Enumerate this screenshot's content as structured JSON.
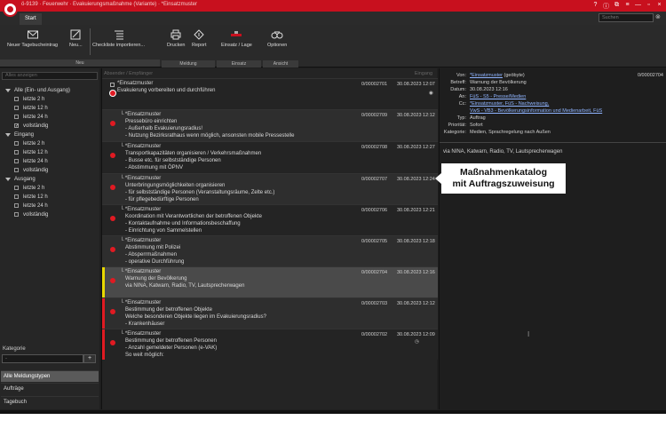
{
  "window": {
    "title": "ö-9139 · Feuerwehr · Evakuierungsmaßnahme (Variante) · *Einsatzmuster",
    "controls": [
      "?",
      "ⓘ",
      "⧉",
      "≡",
      "—",
      "▫",
      "×"
    ]
  },
  "tabs": {
    "start": "Start"
  },
  "search": {
    "placeholder": "Suchen"
  },
  "ribbon": {
    "buttons": {
      "neuer_tagebucheintrag": "Neuer Tagebucheintrag",
      "neu": "Neu...",
      "checkliste": "Checkliste importieren...",
      "drucken": "Drucken",
      "report": "Report",
      "einsatz_lage": "Einsatz / Lage",
      "optionen": "Optionen"
    },
    "groups": {
      "neu": "Neu",
      "meldung": "Meldung",
      "einsatz": "Einsatz",
      "ansicht": "Ansicht"
    }
  },
  "left": {
    "filter_placeholder": "Alles anzeigen",
    "tree": [
      {
        "type": "top",
        "label": "Alle (Ein- und Ausgang)"
      },
      {
        "type": "leaf",
        "label": "letzte 2 h",
        "checked": false
      },
      {
        "type": "leaf",
        "label": "letzte 12 h",
        "checked": false
      },
      {
        "type": "leaf",
        "label": "letzte 24 h",
        "checked": false
      },
      {
        "type": "leaf",
        "label": "vollständig",
        "checked": true
      },
      {
        "type": "top",
        "label": "Eingang"
      },
      {
        "type": "leaf",
        "label": "letzte 2 h",
        "checked": false
      },
      {
        "type": "leaf",
        "label": "letzte 12 h",
        "checked": false
      },
      {
        "type": "leaf",
        "label": "letzte 24 h",
        "checked": false
      },
      {
        "type": "leaf",
        "label": "vollständig",
        "checked": false
      },
      {
        "type": "top",
        "label": "Ausgang"
      },
      {
        "type": "leaf",
        "label": "letzte 2 h",
        "checked": false
      },
      {
        "type": "leaf",
        "label": "letzte 12 h",
        "checked": false
      },
      {
        "type": "leaf",
        "label": "letzte 24 h",
        "checked": false
      },
      {
        "type": "leaf",
        "label": "vollständig",
        "checked": false
      }
    ],
    "kategorie_label": "Kategorie",
    "kategorie_placeholder": "-",
    "kategorie_add": "+",
    "nav": [
      "Alle Meldungstypen",
      "Aufträge",
      "Tagebuch"
    ]
  },
  "middle": {
    "header_left": "Absender / Empfänger",
    "header_right": "Eingang",
    "messages": [
      {
        "sender": "*Einsatzmuster",
        "lines": [
          "Evakuierung vorbereiten und durchführen"
        ],
        "id": "0/00002701",
        "date": "30.08.2023 12:07",
        "reply": false,
        "first": true
      },
      {
        "sender": "*Einsatzmuster",
        "lines": [
          "Pressebüro einrichten",
          "- Außerhalb Evakuierungsradius!",
          "- Nutzung Bezirksrathaus wenn möglich, ansonsten mobile Pressestelle"
        ],
        "id": "0/00002709",
        "date": "30.08.2023 12:12",
        "reply": true
      },
      {
        "sender": "*Einsatzmuster",
        "lines": [
          "Transportkapazitäten organisieren / Verkehrsmaßnahmen",
          "- Busse etc. für selbstständige Personen",
          "- Abstimmung mit ÖPNV"
        ],
        "id": "0/00002708",
        "date": "30.08.2023 12:27",
        "reply": true
      },
      {
        "sender": "*Einsatzmuster",
        "lines": [
          "Unterbringungsmöglichkeiten organisieren",
          "- für selbstständige Personen (Veranstaltungsräume, Zelte etc.)",
          "- für pflegebedürftige Personen"
        ],
        "id": "0/00002707",
        "date": "30.08.2023 12:24",
        "reply": true
      },
      {
        "sender": "*Einsatzmuster",
        "lines": [
          "Koordination mit Verantwortlichen der betroffenen Objekte",
          "- Kontaktaufnahme und Informationsbeschaffung",
          "- Einrichtung von Sammelstellen"
        ],
        "id": "0/00002706",
        "date": "30.08.2023 12:21",
        "reply": true
      },
      {
        "sender": "*Einsatzmuster",
        "lines": [
          "Abstimmung mit Polizei",
          "- Absperrmaßnahmen",
          "- operative Durchführung"
        ],
        "id": "0/00002705",
        "date": "30.08.2023 12:18",
        "reply": true
      },
      {
        "sender": "*Einsatzmuster",
        "lines": [
          "Warnung der Bevölkerung",
          "via NINA, Katwarn, Radio, TV, Lautsprecherwagen"
        ],
        "id": "0/00002704",
        "date": "30.08.2023 12:16",
        "reply": true
      },
      {
        "sender": "*Einsatzmuster",
        "lines": [
          "Bestimmung der betroffenen Objekte",
          "Welche besonderen Objekte liegen im Evakuierungsradius?",
          "- Krankenhäuser"
        ],
        "id": "0/00002703",
        "date": "30.08.2023 12:12",
        "reply": true
      },
      {
        "sender": "*Einsatzmuster",
        "lines": [
          "Bestimmung der betroffenen Personen",
          "- Anzahl gemeldeter Personen (e-VAK)",
          "So weit möglich:"
        ],
        "id": "0/00002702",
        "date": "30.08.2023 12:09",
        "reply": true
      }
    ]
  },
  "detail": {
    "number": "0/00002704",
    "rows": [
      {
        "label": "Von:",
        "value": "*Einsatzmuster",
        "suffix": " (geöbyte)",
        "link": true
      },
      {
        "label": "Betreff:",
        "value": "Warnung der Bevölkerung",
        "link": false
      },
      {
        "label": "Datum:",
        "value": "30.08.2023 12:16",
        "link": false
      },
      {
        "label": "An:",
        "value": "FüS - S5 - Presse/Medien",
        "link": true
      },
      {
        "label": "Cc:",
        "value": "*Einsatzmuster, FüS - Nachweisung,",
        "link": true
      },
      {
        "label": "",
        "value": "VwS - VB3 - Bevölkerungsinformation und Medienarbeit, FüS",
        "link": true
      },
      {
        "label": "Typ:",
        "value": "Auftrag",
        "link": false
      },
      {
        "label": "Priorität:",
        "value": "Sofort",
        "link": false
      },
      {
        "label": "Kategorie:",
        "value": "Medien, Sprachregelung nach Außen",
        "link": false
      }
    ],
    "body": "via NINA, Katwarn, Radio, TV, Lautsprecherwagen"
  },
  "callout": {
    "line1": "Maßnahmenkatalog",
    "line2": "mit Auftragszuweisung"
  },
  "colors": {
    "titlebar": "#c8101e",
    "priority_red": "#e01a22",
    "selected_yellow": "#e8d800"
  }
}
